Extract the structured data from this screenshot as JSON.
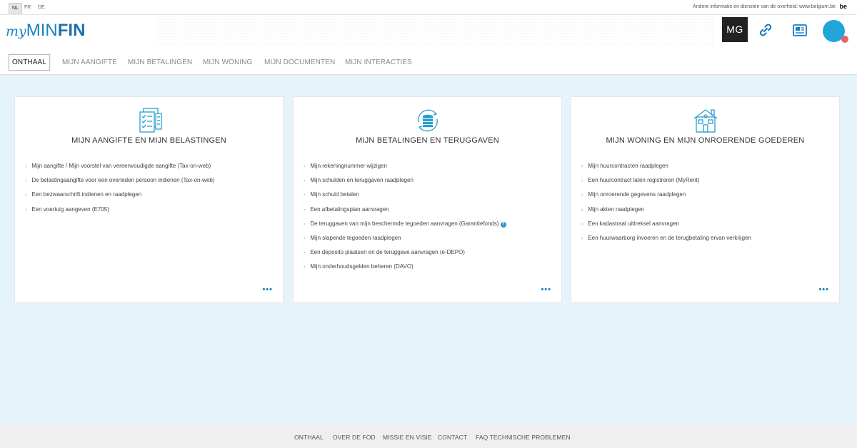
{
  "topbar": {
    "languages": [
      {
        "code": "NL",
        "active": true
      },
      {
        "code": "FR",
        "active": false
      },
      {
        "code": "DE",
        "active": false
      }
    ],
    "gov_text": "Andere informatie en diensten van de overheid: www.belgium.be",
    "be_logo": "be"
  },
  "header": {
    "logo_my": "my",
    "logo_min": "MIN",
    "logo_fin": "FIN",
    "user_initials": "MG",
    "icons": [
      "link-icon",
      "news-icon",
      "avatar"
    ]
  },
  "nav": {
    "tabs": [
      {
        "label": "ONTHAAL",
        "active": true
      },
      {
        "label": "MIJN AANGIFTE"
      },
      {
        "label": "MIJN BETALINGEN"
      },
      {
        "label": "MIJN WONING"
      },
      {
        "label": "MIJN DOCUMENTEN"
      },
      {
        "label": "MIJN INTERACTIES"
      }
    ]
  },
  "cards": [
    {
      "title": "MIJN AANGIFTE EN MIJN BELASTINGEN",
      "icon": "tax-form-icon",
      "items": [
        "Mijn aangifte / Mijn voorstel van vereenvoudigde aangifte (Tax-on-web)",
        "De belastingaangifte voor een overleden persoon indienen (Tax-on-web)",
        "Een bezwaarschrift indienen en raadplegen",
        "Een voertuig aangeven (E705)"
      ],
      "more": "•••"
    },
    {
      "title": "MIJN BETALINGEN EN TERUGGAVEN",
      "icon": "coins-refund-icon",
      "items": [
        "Mijn rekeningnummer wijzigen",
        "Mijn schulden en teruggaven raadplegen",
        "Mijn schuld betalen",
        "Een afbetalingsplan aanvragen",
        "De teruggaven van mijn beschermde tegoeden aanvragen (Garantiefonds)",
        "Mijn slapende tegoeden raadplegen",
        "Een deposito plaatsen en de teruggave aanvragen (e-DEPO)",
        "Mijn onderhoudsgelden beheren (DAVO)"
      ],
      "help_mark": "?",
      "more": "•••"
    },
    {
      "title": "MIJN WONING EN MIJN ONROERENDE GOEDEREN",
      "icon": "house-icon",
      "items": [
        "Mijn huurcontracten raadplegen",
        "Een huurcontract laten registreren (MyRent)",
        "Mijn onroerende gegevens raadplegen",
        "Mijn akten raadplegen",
        "Een kadastraal uittreksel aanvragen",
        "Een huurwaarborg invoeren en de terugbetaling ervan verkrijgen"
      ],
      "more": "•••"
    }
  ],
  "footer": {
    "links": [
      "ONTHAAL",
      "OVER DE FOD",
      "MISSIE EN VISIE",
      "CONTACT",
      "FAQ TECHNISCHE PROBLEMEN"
    ]
  },
  "colors": {
    "brand_blue": "#1a7fc0",
    "page_bg": "#e5f3fa",
    "icon_teal": "#2a9fd0",
    "notification": "#e76169"
  }
}
